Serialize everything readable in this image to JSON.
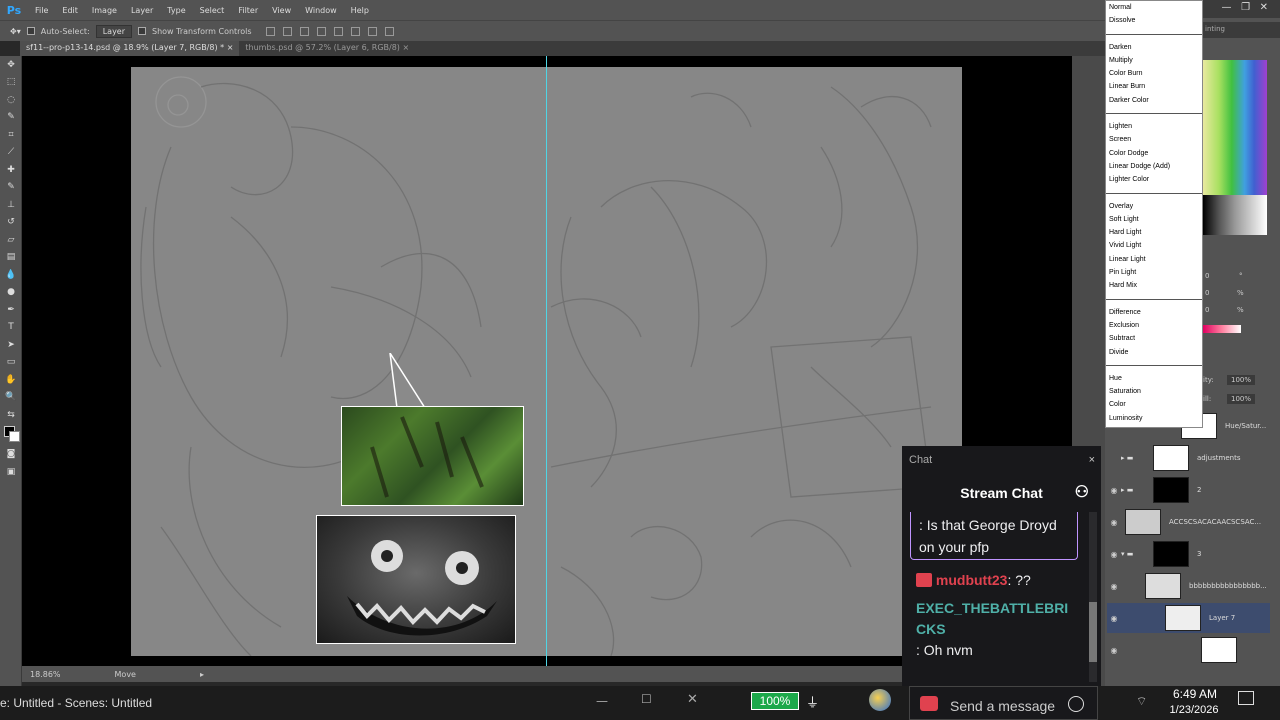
{
  "app": {
    "logo": "Ps"
  },
  "menu": [
    "File",
    "Edit",
    "Image",
    "Layer",
    "Type",
    "Select",
    "Filter",
    "View",
    "Window",
    "Help"
  ],
  "options": {
    "auto_select_label": "Auto-Select:",
    "auto_select_value": "Layer",
    "transform_label": "Show Transform Controls",
    "workspace": "inting"
  },
  "tabs": [
    {
      "label": "sf11--pro-p13-14.psd @ 18.9% (Layer 7, RGB/8) *"
    },
    {
      "label": "thumbs.psd @ 57.2% (Layer 6, RGB/8)"
    }
  ],
  "status": {
    "zoom": "18.86%",
    "tool": "Move"
  },
  "blend_modes": {
    "group1": [
      "Normal",
      "Dissolve"
    ],
    "group2": [
      "Darken",
      "Multiply",
      "Color Burn",
      "Linear Burn",
      "Darker Color"
    ],
    "group3": [
      "Lighten",
      "Screen",
      "Color Dodge",
      "Linear Dodge (Add)",
      "Lighter Color"
    ],
    "group4": [
      "Overlay",
      "Soft Light",
      "Hard Light",
      "Vivid Light",
      "Linear Light",
      "Pin Light",
      "Hard Mix"
    ],
    "group5": [
      "Difference",
      "Exclusion",
      "Subtract",
      "Divide"
    ],
    "group6": [
      "Hue",
      "Saturation",
      "Color",
      "Luminosity"
    ]
  },
  "adjust": {
    "v1": "0",
    "v2": "0",
    "v3": "0",
    "pct": "%",
    "deg": "°"
  },
  "layers_panel": {
    "opacity_label": "ity:",
    "opacity": "100%",
    "fill_label": "ill:",
    "fill": "100%"
  },
  "layers": [
    {
      "name": "Hue/Satur..."
    },
    {
      "name": "adjustments"
    },
    {
      "name": "2"
    },
    {
      "name": "ACCSCSACACAACSCSAC..."
    },
    {
      "name": "3"
    },
    {
      "name": "bbbbbbbbbbbbbbbb..."
    },
    {
      "name": "Layer 7"
    }
  ],
  "chat": {
    "header": "Chat",
    "close": "×",
    "title": "Stream Chat",
    "messages": [
      {
        "text": ": Is that George Droyd on your pfp"
      },
      {
        "user": "mudbutt23",
        "text": ": ??"
      },
      {
        "user": "EXEC_THEBATTLEBRICKS",
        "text": ": Oh nvm"
      }
    ],
    "input_placeholder": "Send a message",
    "user_color": "#e0424f",
    "user2_color": "#4fb0a8"
  },
  "taskbar": {
    "obs": "e: Untitled - Scenes: Untitled",
    "battery": "100%",
    "time": "6:49 AM",
    "date": "1/23/2026"
  }
}
